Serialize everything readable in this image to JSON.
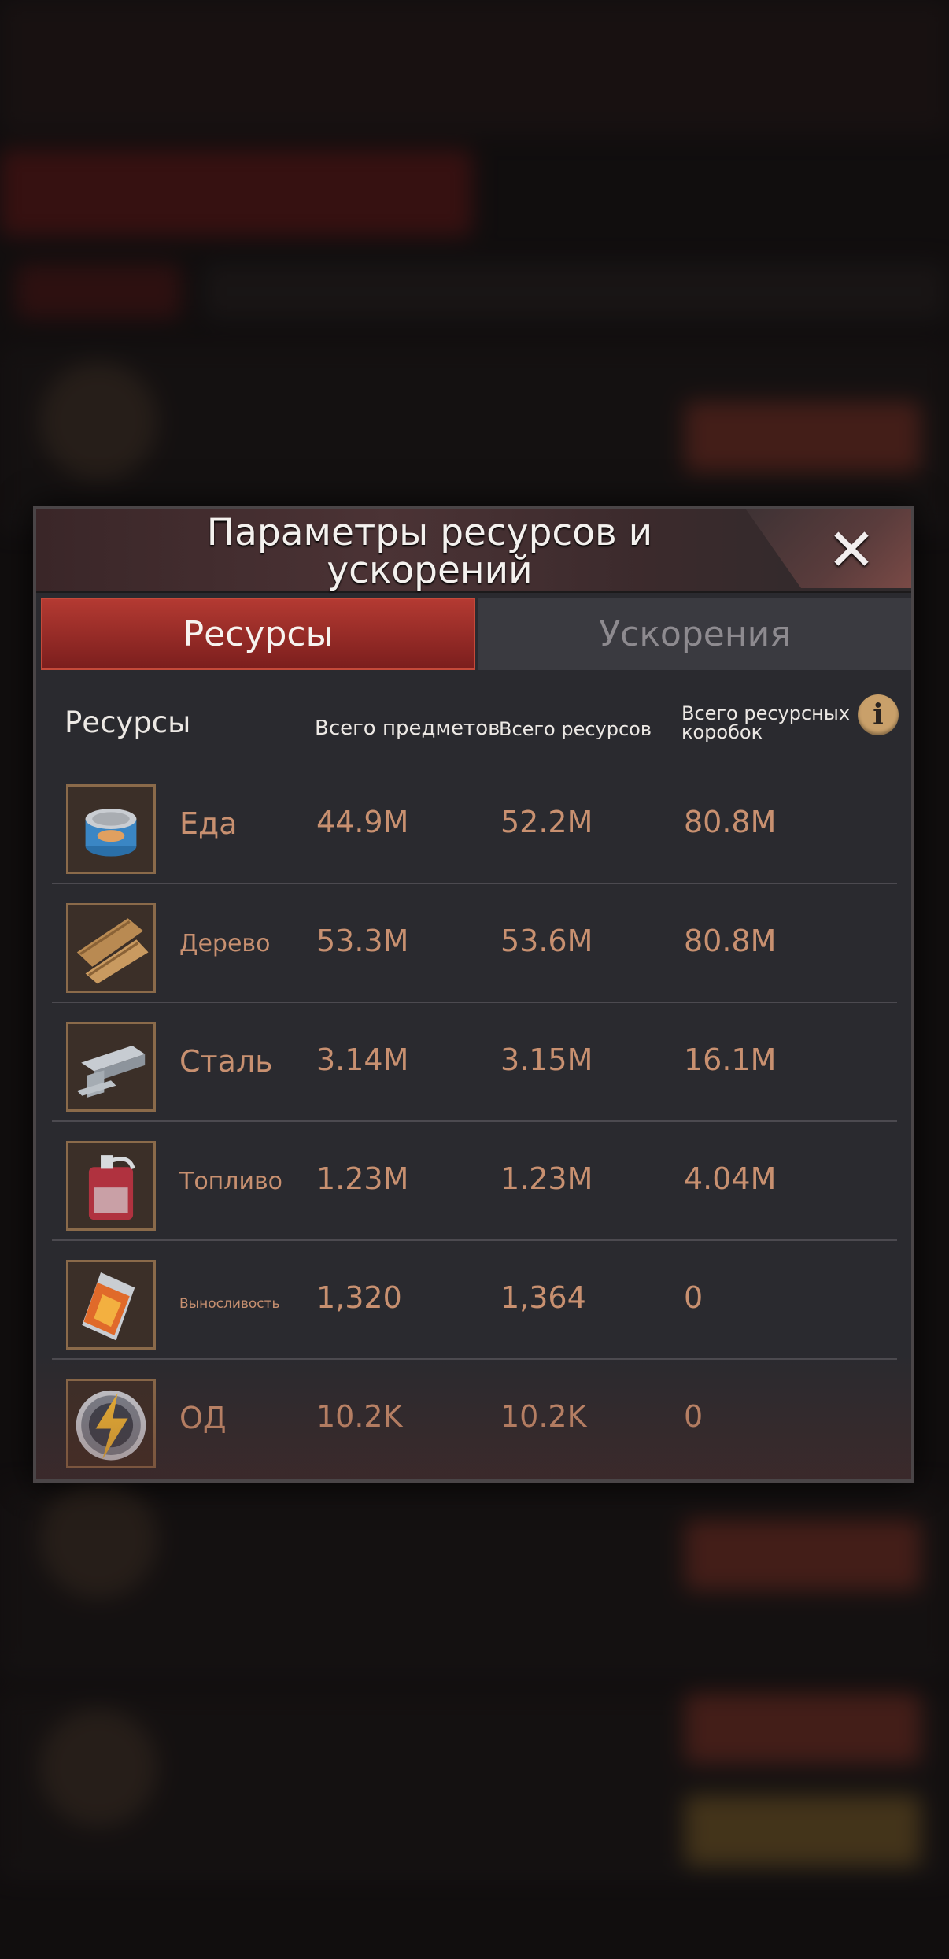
{
  "popup": {
    "title": "Параметры ресурсов и ускорений",
    "close_glyph": "✕"
  },
  "tabs": [
    {
      "label": "Ресурсы",
      "active": true
    },
    {
      "label": "Ускорения",
      "active": false
    }
  ],
  "table": {
    "headers": {
      "resources": "Ресурсы",
      "total_items": "Всего предметов",
      "total_resources": "Всего ресурсов",
      "total_boxes": "Всего ресурсных коробок"
    },
    "info_icon": "i",
    "rows": [
      {
        "name": "Еда",
        "icon": "food-can-icon",
        "items": "44.9M",
        "resources": "52.2M",
        "boxes": "80.8M"
      },
      {
        "name": "Дерево",
        "icon": "wood-planks-icon",
        "items": "53.3M",
        "resources": "53.6M",
        "boxes": "80.8M"
      },
      {
        "name": "Сталь",
        "icon": "steel-beam-icon",
        "items": "3.14M",
        "resources": "3.15M",
        "boxes": "16.1M"
      },
      {
        "name": "Топливо",
        "icon": "fuel-canister-icon",
        "items": "1.23M",
        "resources": "1.23M",
        "boxes": "4.04M"
      },
      {
        "name": "Выносливость",
        "icon": "energy-drink-icon",
        "items": "1,320",
        "resources": "1,364",
        "boxes": "0"
      },
      {
        "name": "ОД",
        "icon": "lightning-bolt-icon",
        "items": "10.2K",
        "resources": "10.2K",
        "boxes": "0"
      }
    ]
  },
  "colors": {
    "accent_red": "#b43a32",
    "value_text": "#c89070",
    "info_gold": "#c9a06a"
  }
}
